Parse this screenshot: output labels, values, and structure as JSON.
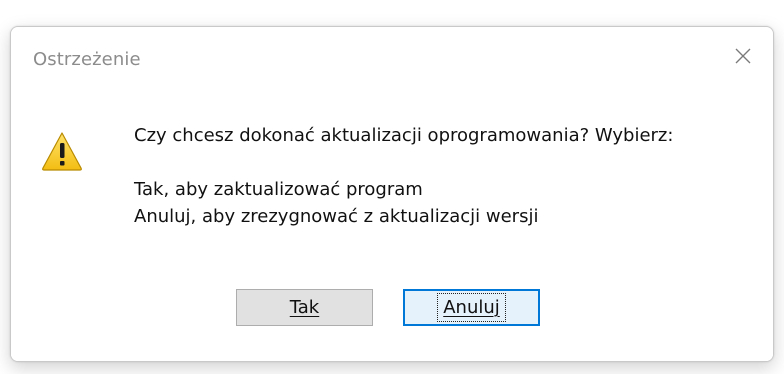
{
  "dialog": {
    "title": "Ostrzeżenie",
    "close_icon": "close-icon",
    "icon": "warning-icon",
    "message_lines": [
      "Czy chcesz dokonać aktualizacji oprogramowania? Wybierz:",
      "Tak, aby zaktualizować program",
      "Anuluj, aby zrezygnować z aktualizacji wersji"
    ],
    "buttons": {
      "yes_label": "Tak",
      "cancel_label": "Anuluj"
    }
  },
  "colors": {
    "warning_fill": "#f7d22a",
    "focus_border": "#0078d7"
  }
}
